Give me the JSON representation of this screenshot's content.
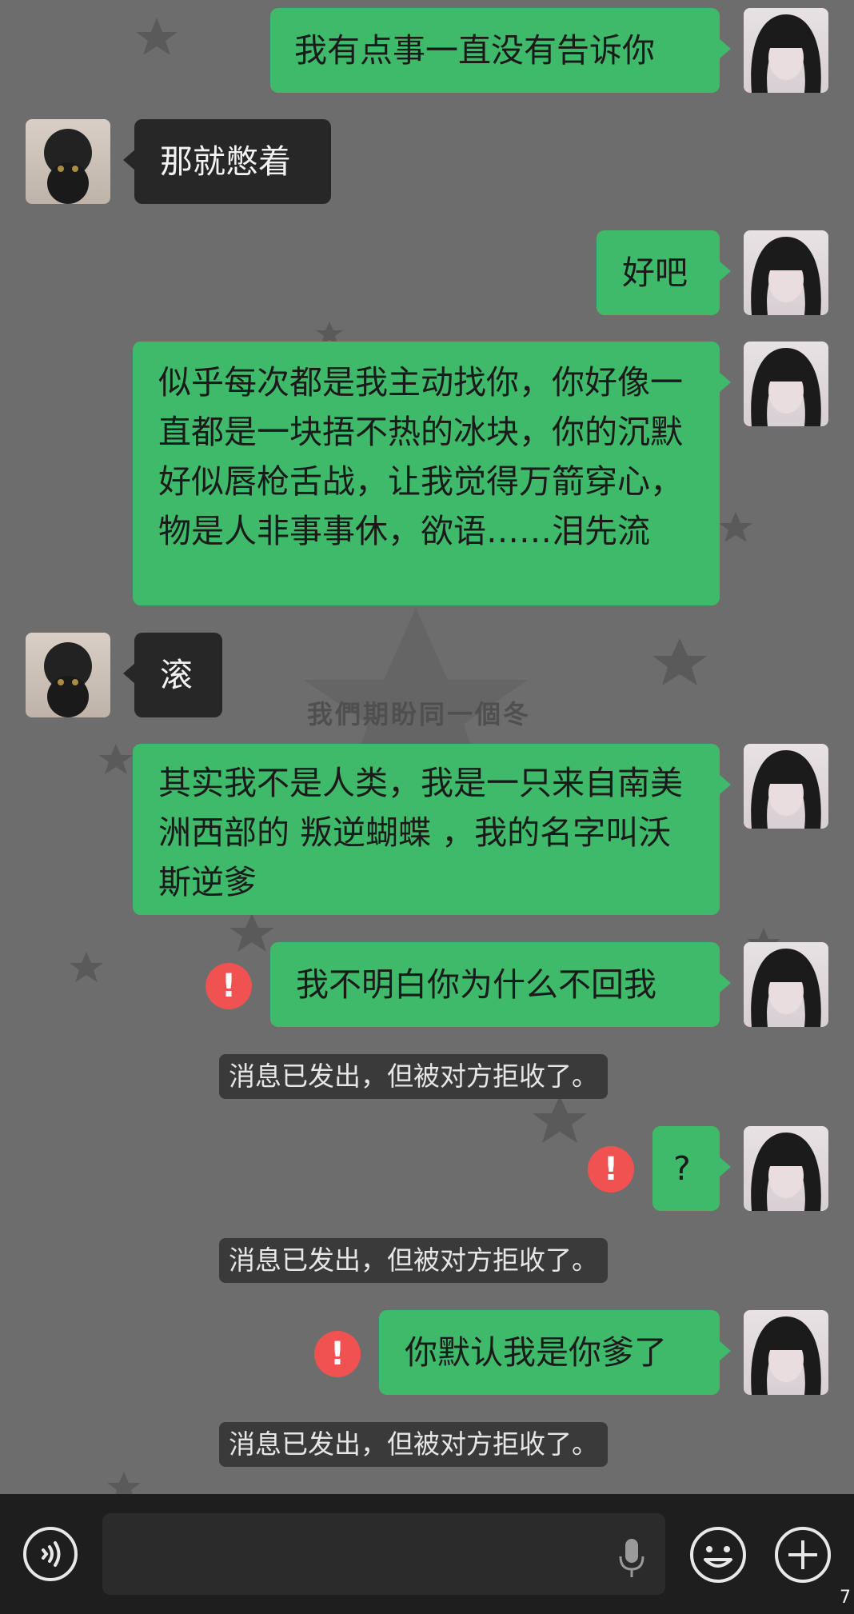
{
  "chat": {
    "watermark": "我們期盼同一個冬",
    "messages": [
      {
        "side": "out",
        "text": "我有点事一直没有告诉你"
      },
      {
        "side": "in",
        "text": "那就憋着"
      },
      {
        "side": "out",
        "text": "好吧"
      },
      {
        "side": "out",
        "text": "似乎每次都是我主动找你，你好像一直都是一块捂不热的冰块，你的沉默好似唇枪舌战，让我觉得万箭穿心，物是人非事事休，欲语……泪先流"
      },
      {
        "side": "in",
        "text": "滚"
      },
      {
        "side": "out",
        "text": "其实我不是人类，我是一只来自南美洲西部的 叛逆蝴蝶 ，我的名字叫沃斯逆爹"
      },
      {
        "side": "out",
        "text": "我不明白你为什么不回我",
        "failed": true,
        "notice": "消息已发出，但被对方拒收了。"
      },
      {
        "side": "out",
        "text": "?",
        "failed": true,
        "notice": "消息已发出，但被对方拒收了。"
      },
      {
        "side": "out",
        "text": "你默认我是你爹了",
        "failed": true,
        "notice": "消息已发出，但被对方拒收了。"
      }
    ]
  },
  "error_mark": "!",
  "bottom": {
    "voice_icon": "voice-icon",
    "mic_icon": "microphone-icon",
    "emoji_icon": "emoji-icon",
    "plus_icon": "plus-icon",
    "page_number": "7"
  },
  "colors": {
    "background": "#6d6d6d",
    "out_bubble": "#3fb96a",
    "in_bubble": "#272727",
    "error": "#f05252"
  }
}
